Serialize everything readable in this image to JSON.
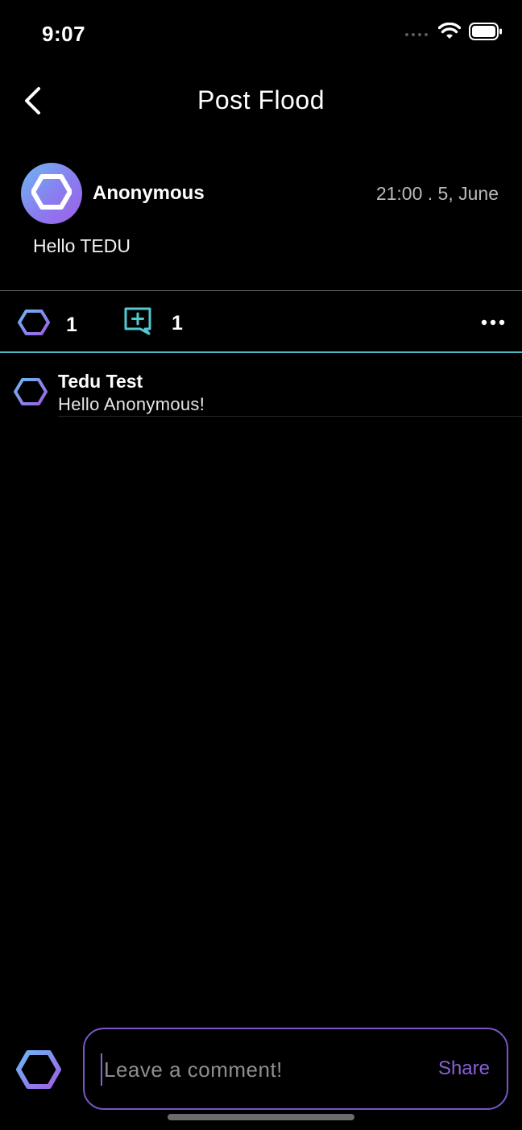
{
  "status_bar": {
    "time": "9:07",
    "icons": [
      "signal-icon",
      "wifi-icon",
      "battery-icon"
    ]
  },
  "nav": {
    "title": "Post Flood",
    "back_icon": "chevron-left-icon"
  },
  "post": {
    "author": "Anonymous",
    "time": "21:00 . 5, June",
    "body": "Hello TEDU"
  },
  "actions": {
    "like_count": "1",
    "comment_count": "1",
    "like_icon": "hexagon-icon",
    "comment_icon": "add-comment-icon",
    "more_icon": "more-horizontal-icon"
  },
  "comments": [
    {
      "author": "Tedu Test",
      "text": "Hello Anonymous!"
    }
  ],
  "composer": {
    "placeholder": "Leave a comment!",
    "value": "",
    "share_label": "Share"
  },
  "colors": {
    "accent_teal": "#4fb9c4",
    "accent_purple": "#8a5fd6",
    "hex_gradient_start": "#6db8f2",
    "hex_gradient_end": "#9d5fe6"
  }
}
